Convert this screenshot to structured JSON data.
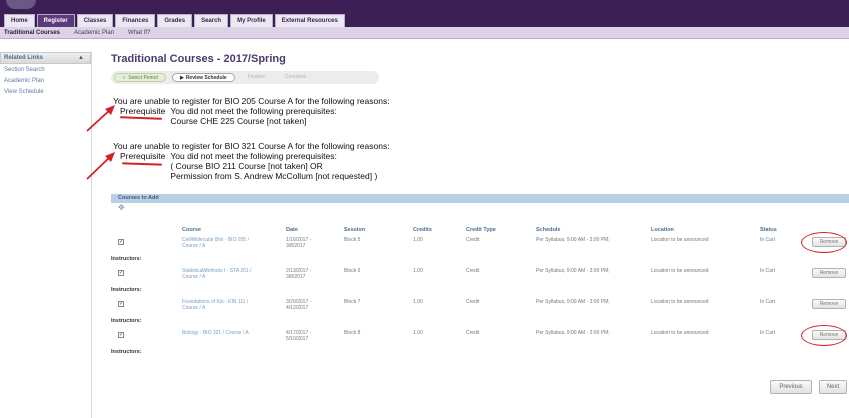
{
  "nav": {
    "tabs": [
      "Home",
      "Register",
      "Classes",
      "Finances",
      "Grades",
      "Search",
      "My Profile",
      "External Resources"
    ],
    "active": "Register"
  },
  "subnav": {
    "items": [
      "Traditional Courses",
      "Academic Plan",
      "What If?"
    ],
    "active": "Traditional Courses"
  },
  "sidebar": {
    "title": "Related Links",
    "collapse_glyph": "▲",
    "links": [
      "Section Search",
      "Academic Plan",
      "View Schedule"
    ]
  },
  "page": {
    "title": "Traditional Courses - 2017/Spring"
  },
  "steps": {
    "items": [
      {
        "label": "Select Period",
        "state": "done",
        "mark": "✓"
      },
      {
        "label": "Review Schedule",
        "state": "current",
        "mark": "▶"
      },
      {
        "label": "Finalize",
        "state": "pending",
        "mark": ""
      },
      {
        "label": "Complete",
        "state": "pending",
        "mark": ""
      }
    ]
  },
  "errors": [
    {
      "heading": "You are unable to register for BIO 205 Course A for the following reasons:",
      "reason_label": "Prerequisite",
      "lines": [
        "You did not meet the following prerequisites:",
        "Course CHE 225 Course [not taken]"
      ]
    },
    {
      "heading": "You are unable to register for BIO 321 Course A for the following reasons:",
      "reason_label": "Prerequisite",
      "lines": [
        "You did not meet the following prerequisites:",
        "( Course BIO 211 Course [not taken] OR",
        "Permission from S. Andrew McCollum [not requested] )"
      ]
    }
  ],
  "courses": {
    "panel_title": "Courses to Add",
    "refresh_glyph": "✥",
    "headers": [
      "Course",
      "Date",
      "Session",
      "Credits",
      "Credit Type",
      "Schedule",
      "Location",
      "Status"
    ],
    "instructors_label": "Instructors:",
    "remove_label": "Remove",
    "check_glyph": "✓",
    "rows": [
      {
        "course_1": "Cell/Molecular Biol - BIO 205 /",
        "course_2": "Course / A",
        "date_1": "1/16/2017 -",
        "date_2": "3/8/2017",
        "session": "Block 5",
        "credits": "1.00",
        "credit_type": "Credit",
        "schedule": "Per Syllabus, 9:00 AM - 3:00 PM;",
        "location": "Location to be announced",
        "status": "In Cart"
      },
      {
        "course_1": "StatisticalMethods I - STA 201 /",
        "course_2": "Course / A",
        "date_1": "2/13/2017 -",
        "date_2": "3/8/2017",
        "session": "Block 6",
        "credits": "1.00",
        "credit_type": "Credit",
        "schedule": "Per Syllabus, 9:00 AM - 3:00 PM;",
        "location": "Location to be announced",
        "status": "In Cart"
      },
      {
        "course_1": "Foundations of Kin - KIN 111 /",
        "course_2": "Course / A",
        "date_1": "3/20/2017 -",
        "date_2": "4/12/2017",
        "session": "Block 7",
        "credits": "1.00",
        "credit_type": "Credit",
        "schedule": "Per Syllabus, 9:00 AM - 3:00 PM;",
        "location": "Location to be announced",
        "status": "In Cart"
      },
      {
        "course_1": "Biology - BIO 321 / Course / A",
        "course_2": "",
        "date_1": "4/17/2017 -",
        "date_2": "5/10/2017",
        "session": "Block 8",
        "credits": "1.00",
        "credit_type": "Credit",
        "schedule": "Per Syllabus, 9:00 AM - 3:00 PM;",
        "location": "Location to be announced",
        "status": "In Cart"
      }
    ]
  },
  "footer": {
    "previous_label": "Previous",
    "next_label": "Next"
  },
  "colors": {
    "annotation": "#d4202a",
    "brand": "#3b1f55"
  }
}
